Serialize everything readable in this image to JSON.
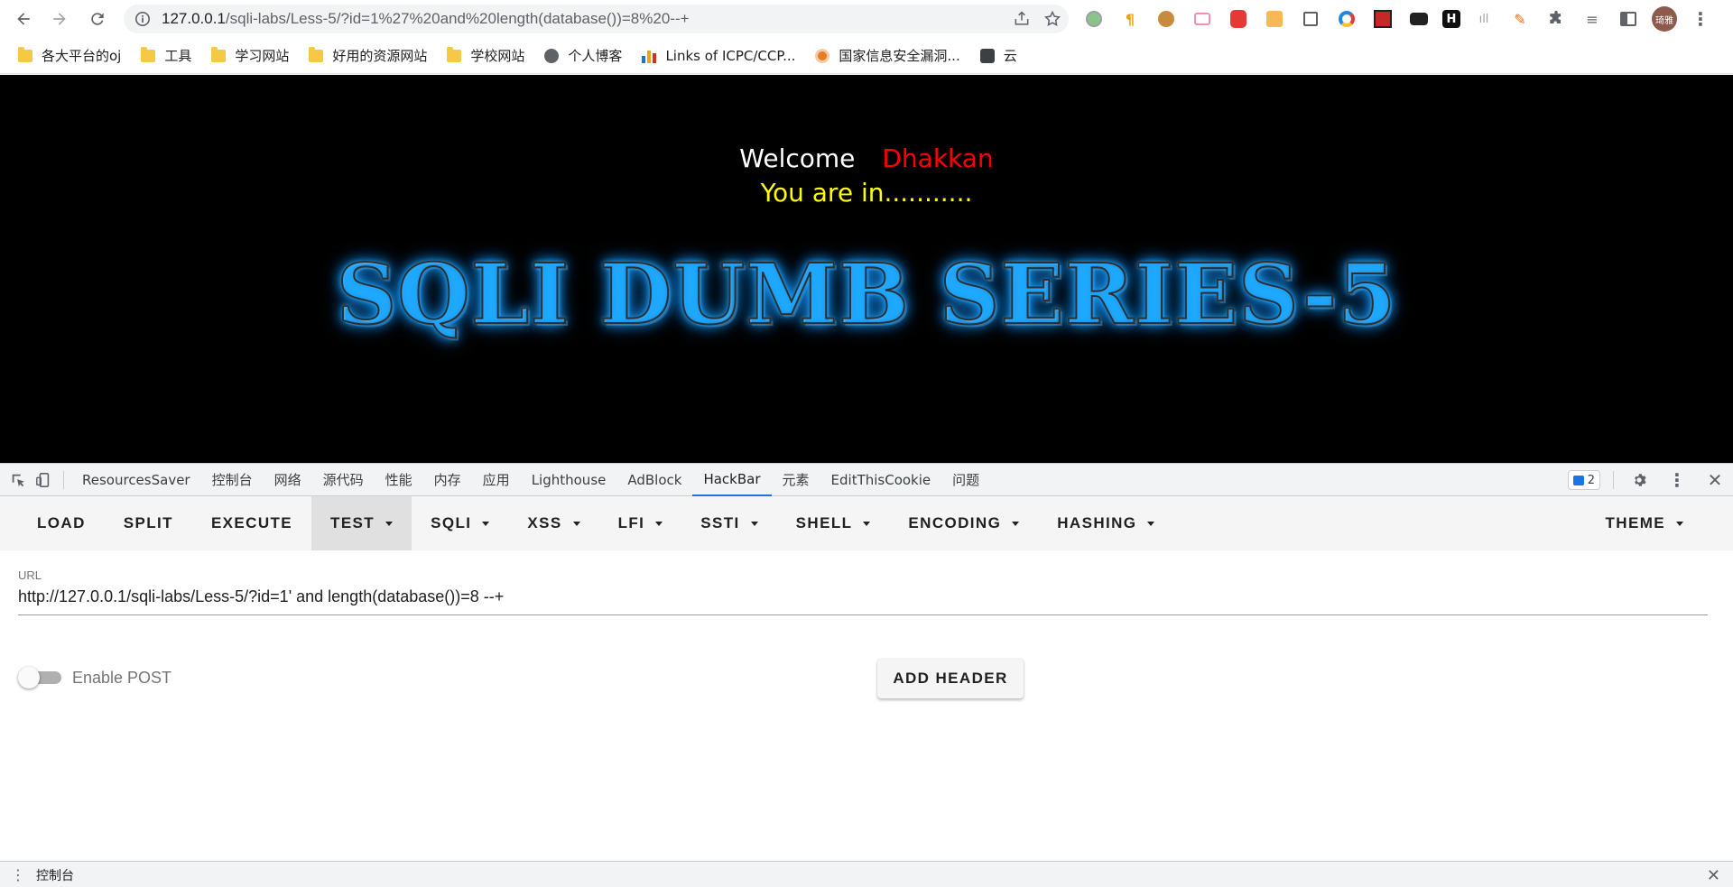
{
  "browser": {
    "url_host": "127.0.0.1",
    "url_path": "/sqli-labs/Less-5/?id=1%27%20and%20length(database())=8%20--+",
    "avatar_text": "琦雅"
  },
  "bookmarks": [
    {
      "label": "各大平台的oj",
      "icon": "folder-icon"
    },
    {
      "label": "工具",
      "icon": "folder-icon"
    },
    {
      "label": "学习网站",
      "icon": "folder-icon"
    },
    {
      "label": "好用的资源网站",
      "icon": "folder-icon"
    },
    {
      "label": "学校网站",
      "icon": "folder-icon"
    },
    {
      "label": "个人博客",
      "icon": "globe-icon"
    },
    {
      "label": "Links of ICPC/CCP...",
      "icon": "chart-icon"
    },
    {
      "label": "国家信息安全漏洞...",
      "icon": "site-icon"
    },
    {
      "label": "云",
      "icon": "site-icon"
    }
  ],
  "page": {
    "welcome": "Welcome",
    "name": "Dhakkan",
    "status": "You are in...........",
    "banner": "SQLI DUMB SERIES-5"
  },
  "devtools": {
    "tabs": [
      "ResourcesSaver",
      "控制台",
      "网络",
      "源代码",
      "性能",
      "内存",
      "应用",
      "Lighthouse",
      "AdBlock",
      "HackBar",
      "元素",
      "EditThisCookie",
      "问题"
    ],
    "active_tab": "HackBar",
    "issues_count": "2",
    "drawer_label": "控制台"
  },
  "hackbar": {
    "buttons": {
      "load": "LOAD",
      "split": "SPLIT",
      "execute": "EXECUTE",
      "test": "TEST",
      "sqli": "SQLI",
      "xss": "XSS",
      "lfi": "LFI",
      "ssti": "SSTI",
      "shell": "SHELL",
      "encoding": "ENCODING",
      "hashing": "HASHING",
      "theme": "THEME"
    },
    "url_label": "URL",
    "url_value": "http://127.0.0.1/sqli-labs/Less-5/?id=1' and length(database())=8 --+",
    "enable_post_label": "Enable POST",
    "add_header_label": "ADD HEADER"
  },
  "colors": {
    "page_bg": "#000000",
    "welcome_text": "#ffffff",
    "name_text": "#ff0000",
    "status_text": "#ffff00",
    "accent": "#1a73e8"
  }
}
